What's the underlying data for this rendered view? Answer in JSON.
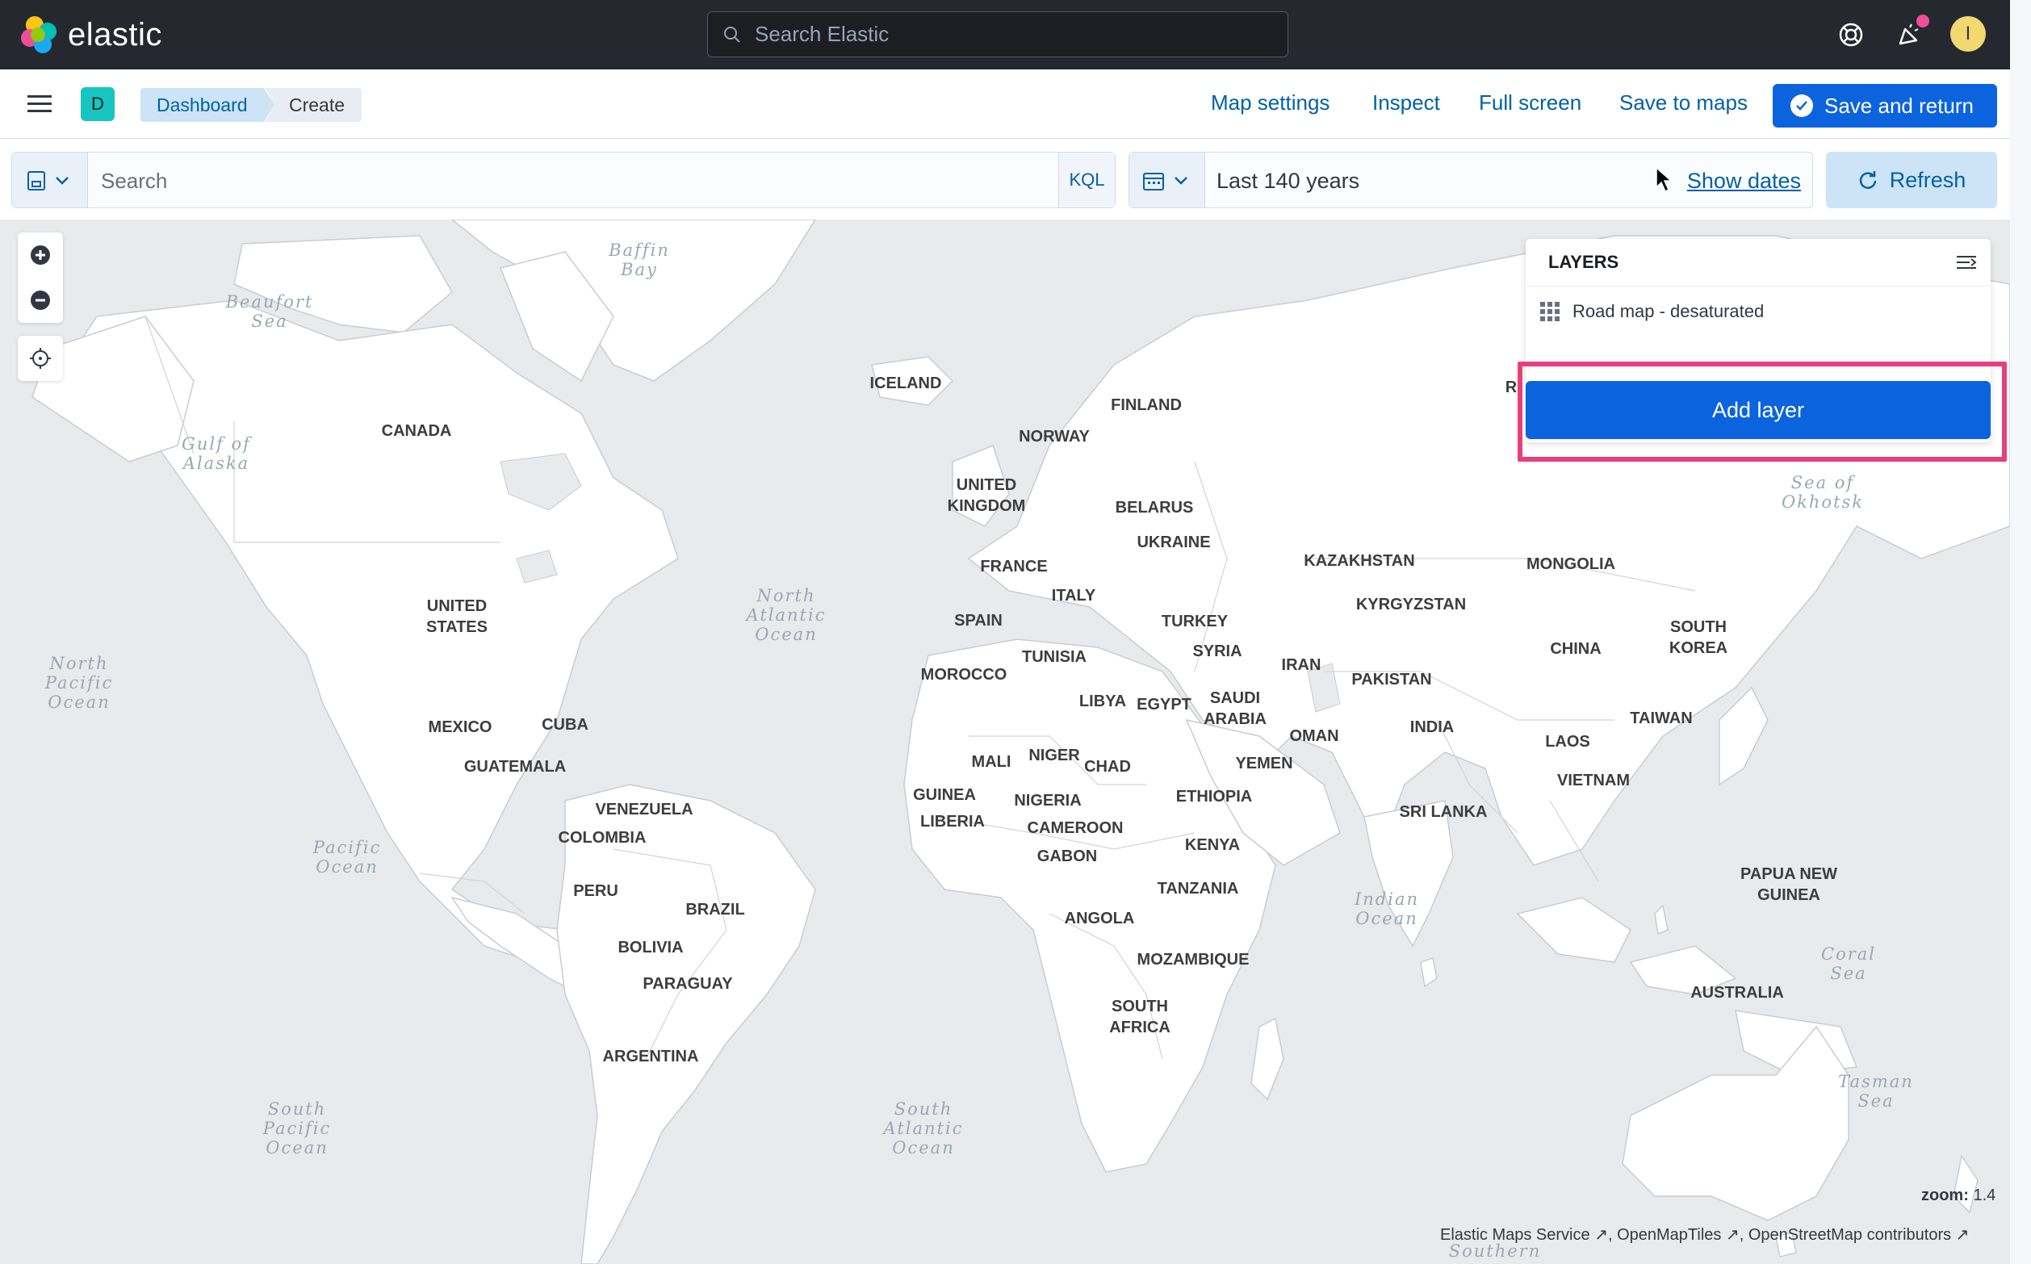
{
  "header": {
    "logo_text": "elastic",
    "search_placeholder": "Search Elastic",
    "avatar_initial": "I",
    "icons": [
      "help-icon",
      "newsfeed-icon",
      "search-icon"
    ]
  },
  "app_bar": {
    "space_initial": "D",
    "breadcrumbs": [
      "Dashboard",
      "Create"
    ],
    "links": {
      "map_settings": "Map settings",
      "inspect": "Inspect",
      "full_screen": "Full screen",
      "save_to_maps": "Save to maps"
    },
    "save_and_return": "Save and return"
  },
  "query_bar": {
    "search_placeholder": "Search",
    "language": "KQL",
    "time_range": "Last 140 years",
    "show_dates": "Show dates",
    "refresh": "Refresh"
  },
  "map": {
    "zoom_label": "zoom:",
    "zoom_value": "1.4",
    "attribution": {
      "ems": "Elastic Maps Service",
      "omt": "OpenMapTiles",
      "osm": "OpenStreetMap contributors"
    },
    "country_labels": {
      "canada": "CANADA",
      "united_states": "UNITED\nSTATES",
      "mexico": "MEXICO",
      "cuba": "CUBA",
      "guatemala": "GUATEMALA",
      "venezuela": "VENEZUELA",
      "colombia": "COLOMBIA",
      "peru": "PERU",
      "brazil": "BRAZIL",
      "bolivia": "BOLIVIA",
      "paraguay": "PARAGUAY",
      "argentina": "ARGENTINA",
      "iceland": "ICELAND",
      "norway": "NORWAY",
      "finland": "FINLAND",
      "united_kingdom": "UNITED\nKINGDOM",
      "belarus": "BELARUS",
      "ukraine": "UKRAINE",
      "france": "FRANCE",
      "italy": "ITALY",
      "spain": "SPAIN",
      "turkey": "TURKEY",
      "syria": "SYRIA",
      "iran": "IRAN",
      "kazakhstan": "KAZAKHSTAN",
      "kyrgyzstan": "KYRGYZSTAN",
      "mongolia": "MONGOLIA",
      "china": "CHINA",
      "south_korea": "SOUTH\nKOREA",
      "pakistan": "PAKISTAN",
      "india": "INDIA",
      "taiwan": "TAIWAN",
      "laos": "LAOS",
      "vietnam": "VIETNAM",
      "sri_lanka": "SRI LANKA",
      "morocco": "MOROCCO",
      "tunisia": "TUNISIA",
      "libya": "LIBYA",
      "egypt": "EGYPT",
      "saudi_arabia": "SAUDI\nARABIA",
      "oman": "OMAN",
      "yemen": "YEMEN",
      "mali": "MALI",
      "niger": "NIGER",
      "chad": "CHAD",
      "guinea": "GUINEA",
      "nigeria": "NIGERIA",
      "liberia": "LIBERIA",
      "cameroon": "CAMEROON",
      "ethiopia": "ETHIOPIA",
      "gabon": "GABON",
      "kenya": "KENYA",
      "tanzania": "TANZANIA",
      "angola": "ANGOLA",
      "mozambique": "MOZAMBIQUE",
      "south_africa": "SOUTH\nAFRICA",
      "papua_new_guinea": "PAPUA NEW\nGUINEA",
      "australia": "AUSTRALIA",
      "russia_partial": "R"
    },
    "ocean_labels": {
      "baffin_bay": "Baffin\nBay",
      "beaufort_sea": "Beaufort\nSea",
      "gulf_of_alaska": "Gulf of\nAlaska",
      "north_pacific": "North\nPacific\nOcean",
      "north_atlantic": "North\nAtlantic\nOcean",
      "pacific": "Pacific\nOcean",
      "south_pacific": "South\nPacific\nOcean",
      "south_atlantic": "South\nAtlantic\nOcean",
      "indian": "Indian\nOcean",
      "sea_of_okhotsk": "Sea of\nOkhotsk",
      "coral_sea": "Coral\nSea",
      "tasman_sea": "Tasman\nSea",
      "southern": "Southern"
    }
  },
  "layers_panel": {
    "title": "LAYERS",
    "layers": [
      {
        "name": "Road map - desaturated",
        "icon": "grid-icon"
      }
    ],
    "add_layer": "Add layer",
    "highlight_color": "#e83f7c"
  },
  "colors": {
    "header_bg": "#25282f",
    "primary": "#0b64dd",
    "link": "#0061a6",
    "map_water": "#e9eaec",
    "map_land": "#ffffff"
  }
}
